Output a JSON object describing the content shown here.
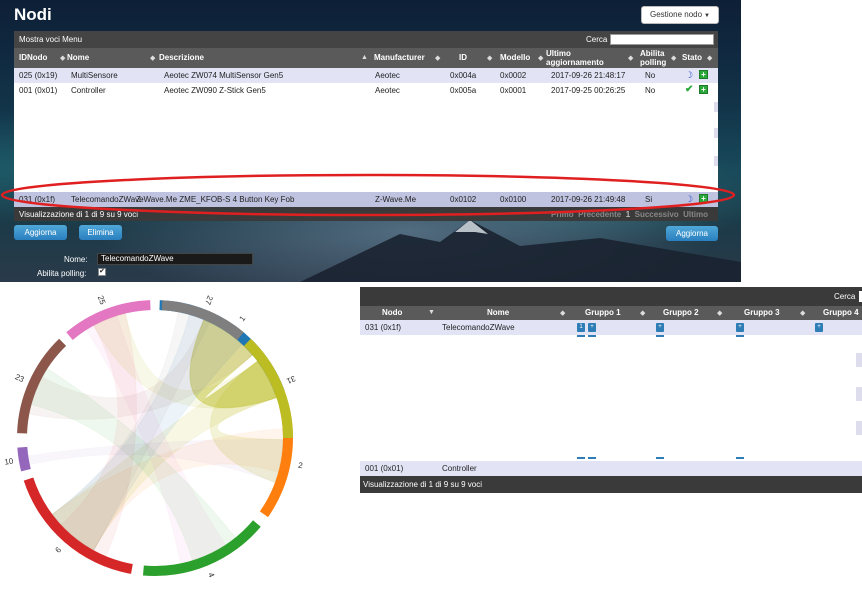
{
  "header": {
    "title": "Nodi",
    "menu_button": "Gestione nodo"
  },
  "nodes_table": {
    "show_entries": "Mostra voci Menu",
    "search_label": "Cerca",
    "columns": [
      "IDNodo",
      "Nome",
      "Descrizione",
      "Manufacturer",
      "ID",
      "Modello",
      "Ultimo aggiornamento",
      "Abilita polling",
      "Stato"
    ],
    "rows": [
      {
        "idnodo": "025 (0x19)",
        "nome": "MultiSensore",
        "descrizione": "Aeotec ZW074 MultiSensor Gen5",
        "manufacturer": "Aeotec",
        "id": "0x004a",
        "modello": "0x0002",
        "ultimo": "2017-09-26 21:48:17",
        "polling": "No",
        "stato_icons": [
          "moon-icon",
          "plus-icon"
        ]
      },
      {
        "idnodo": "001 (0x01)",
        "nome": "Controller",
        "descrizione": "Aeotec ZW090 Z-Stick Gen5",
        "manufacturer": "Aeotec",
        "id": "0x005a",
        "modello": "0x0001",
        "ultimo": "2017-09-25 00:26:25",
        "polling": "No",
        "stato_icons": [
          "check-icon",
          "plus-icon"
        ]
      },
      {
        "idnodo": "031 (0x1f)",
        "nome": "TelecomandoZWave",
        "descrizione": "Z-Wave.Me ZME_KFOB-S 4 Button Key Fob",
        "manufacturer": "Z-Wave.Me",
        "id": "0x0102",
        "modello": "0x0100",
        "ultimo": "2017-09-26 21:49:48",
        "polling": "Si",
        "stato_icons": [
          "moon-icon",
          "plus-icon"
        ]
      }
    ],
    "footer_info": "Visualizzazione di 1 di 9 su 9 voci",
    "pager": {
      "first": "Primo",
      "prev": "Precedente",
      "current": "1",
      "next": "Successivo",
      "last": "Ultimo"
    }
  },
  "buttons": {
    "aggiorna": "Aggiorna",
    "elimina": "Elimina",
    "aggiorna_right": "Aggiorna"
  },
  "form": {
    "name_label": "Nome:",
    "name_value": "TelecomandoZWave",
    "polling_label": "Abilita polling:",
    "polling_checked": true
  },
  "chord": {
    "labels": [
      "1",
      "2",
      "4",
      "6",
      "10",
      "23",
      "25",
      "27",
      "31"
    ],
    "colors": [
      "#1f77b4",
      "#ff7f0e",
      "#2ca02c",
      "#d62728",
      "#9467bd",
      "#8c564b",
      "#e377c2",
      "#7f7f7f",
      "#bcbd22"
    ]
  },
  "groups_table": {
    "search_label": "Cerca",
    "columns": [
      "Nodo",
      "Nome",
      "Gruppo 1",
      "Gruppo 2",
      "Gruppo 3",
      "Gruppo 4"
    ],
    "rows": [
      {
        "nodo": "031 (0x1f)",
        "nome": "TelecomandoZWave",
        "gruppo1_badge": "1"
      },
      {
        "nodo": "001 (0x01)",
        "nome": "Controller"
      }
    ],
    "footer_info": "Visualizzazione di 1 di 9 su 9 voci"
  }
}
